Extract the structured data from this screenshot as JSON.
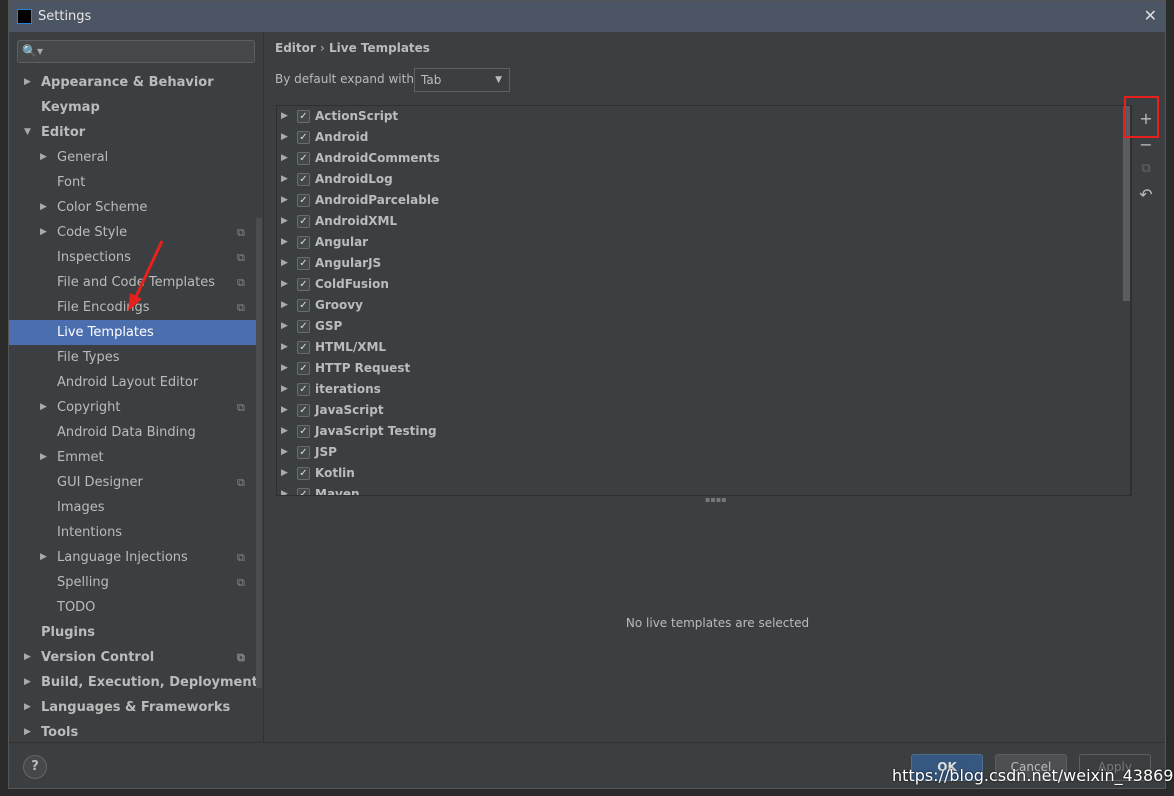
{
  "window": {
    "title": "Settings",
    "logo": "IJ",
    "close": "✕"
  },
  "search": {
    "icon": "🔍▾",
    "placeholder": ""
  },
  "tree": [
    {
      "label": "Appearance & Behavior",
      "level": 0,
      "bold": true,
      "arrow": "right"
    },
    {
      "label": "Keymap",
      "level": 0,
      "bold": true
    },
    {
      "label": "Editor",
      "level": 0,
      "bold": true,
      "arrow": "down"
    },
    {
      "label": "General",
      "level": 1,
      "arrow": "right"
    },
    {
      "label": "Font",
      "level": 1
    },
    {
      "label": "Color Scheme",
      "level": 1,
      "arrow": "right"
    },
    {
      "label": "Code Style",
      "level": 1,
      "arrow": "right",
      "project": true
    },
    {
      "label": "Inspections",
      "level": 1,
      "project": true
    },
    {
      "label": "File and Code Templates",
      "level": 1,
      "project": true
    },
    {
      "label": "File Encodings",
      "level": 1,
      "project": true
    },
    {
      "label": "Live Templates",
      "level": 1,
      "selected": true
    },
    {
      "label": "File Types",
      "level": 1
    },
    {
      "label": "Android Layout Editor",
      "level": 1
    },
    {
      "label": "Copyright",
      "level": 1,
      "arrow": "right",
      "project": true
    },
    {
      "label": "Android Data Binding",
      "level": 1
    },
    {
      "label": "Emmet",
      "level": 1,
      "arrow": "right"
    },
    {
      "label": "GUI Designer",
      "level": 1,
      "project": true
    },
    {
      "label": "Images",
      "level": 1
    },
    {
      "label": "Intentions",
      "level": 1
    },
    {
      "label": "Language Injections",
      "level": 1,
      "arrow": "right",
      "project": true
    },
    {
      "label": "Spelling",
      "level": 1,
      "project": true
    },
    {
      "label": "TODO",
      "level": 1
    },
    {
      "label": "Plugins",
      "level": 0,
      "bold": true
    },
    {
      "label": "Version Control",
      "level": 0,
      "bold": true,
      "arrow": "right",
      "project": true
    },
    {
      "label": "Build, Execution, Deployment",
      "level": 0,
      "bold": true,
      "arrow": "right"
    },
    {
      "label": "Languages & Frameworks",
      "level": 0,
      "bold": true,
      "arrow": "right"
    },
    {
      "label": "Tools",
      "level": 0,
      "bold": true,
      "arrow": "right"
    }
  ],
  "breadcrumb": {
    "parent": "Editor",
    "sep": "›",
    "current": "Live Templates"
  },
  "expand": {
    "label": "By default expand with",
    "value": "Tab"
  },
  "templates": [
    "ActionScript",
    "Android",
    "AndroidComments",
    "AndroidLog",
    "AndroidParcelable",
    "AndroidXML",
    "Angular",
    "AngularJS",
    "ColdFusion",
    "Groovy",
    "GSP",
    "HTML/XML",
    "HTTP Request",
    "iterations",
    "JavaScript",
    "JavaScript Testing",
    "JSP",
    "Kotlin",
    "Maven"
  ],
  "toolbar": {
    "add": "+",
    "remove": "−",
    "copy": "⧉",
    "restore": "↶"
  },
  "empty_text": "No live templates are selected",
  "footer": {
    "help": "?",
    "ok": "OK",
    "cancel": "Cancel",
    "apply": "Apply"
  },
  "watermark": "https://blog.csdn.net/weixin_43869563",
  "colors": {
    "selection": "#4b6eaf",
    "highlight": "#e8201c",
    "ok": "#365880"
  }
}
